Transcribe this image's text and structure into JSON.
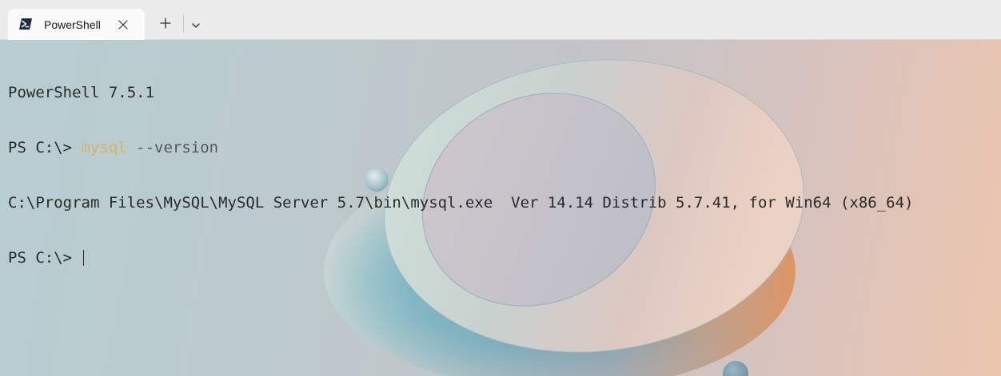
{
  "tabs": [
    {
      "title": "PowerShell",
      "icon": "powershell-icon",
      "active": true
    }
  ],
  "tabstrip": {
    "new_tab_icon": "plus-icon",
    "dropdown_icon": "chevron-down-icon",
    "close_icon": "close-icon"
  },
  "terminal": {
    "lines": [
      {
        "text": "PowerShell 7.5.1"
      },
      {
        "prompt": "PS C:\\> ",
        "command": "mysql",
        "args": " --version"
      },
      {
        "text": "C:\\Program Files\\MySQL\\MySQL Server 5.7\\bin\\mysql.exe  Ver 14.14 Distrib 5.7.41, for Win64 (x86_64)"
      },
      {
        "prompt": "PS C:\\> "
      }
    ]
  },
  "colors": {
    "command_highlight": "#e0b060",
    "text": "#2a2a2a"
  }
}
